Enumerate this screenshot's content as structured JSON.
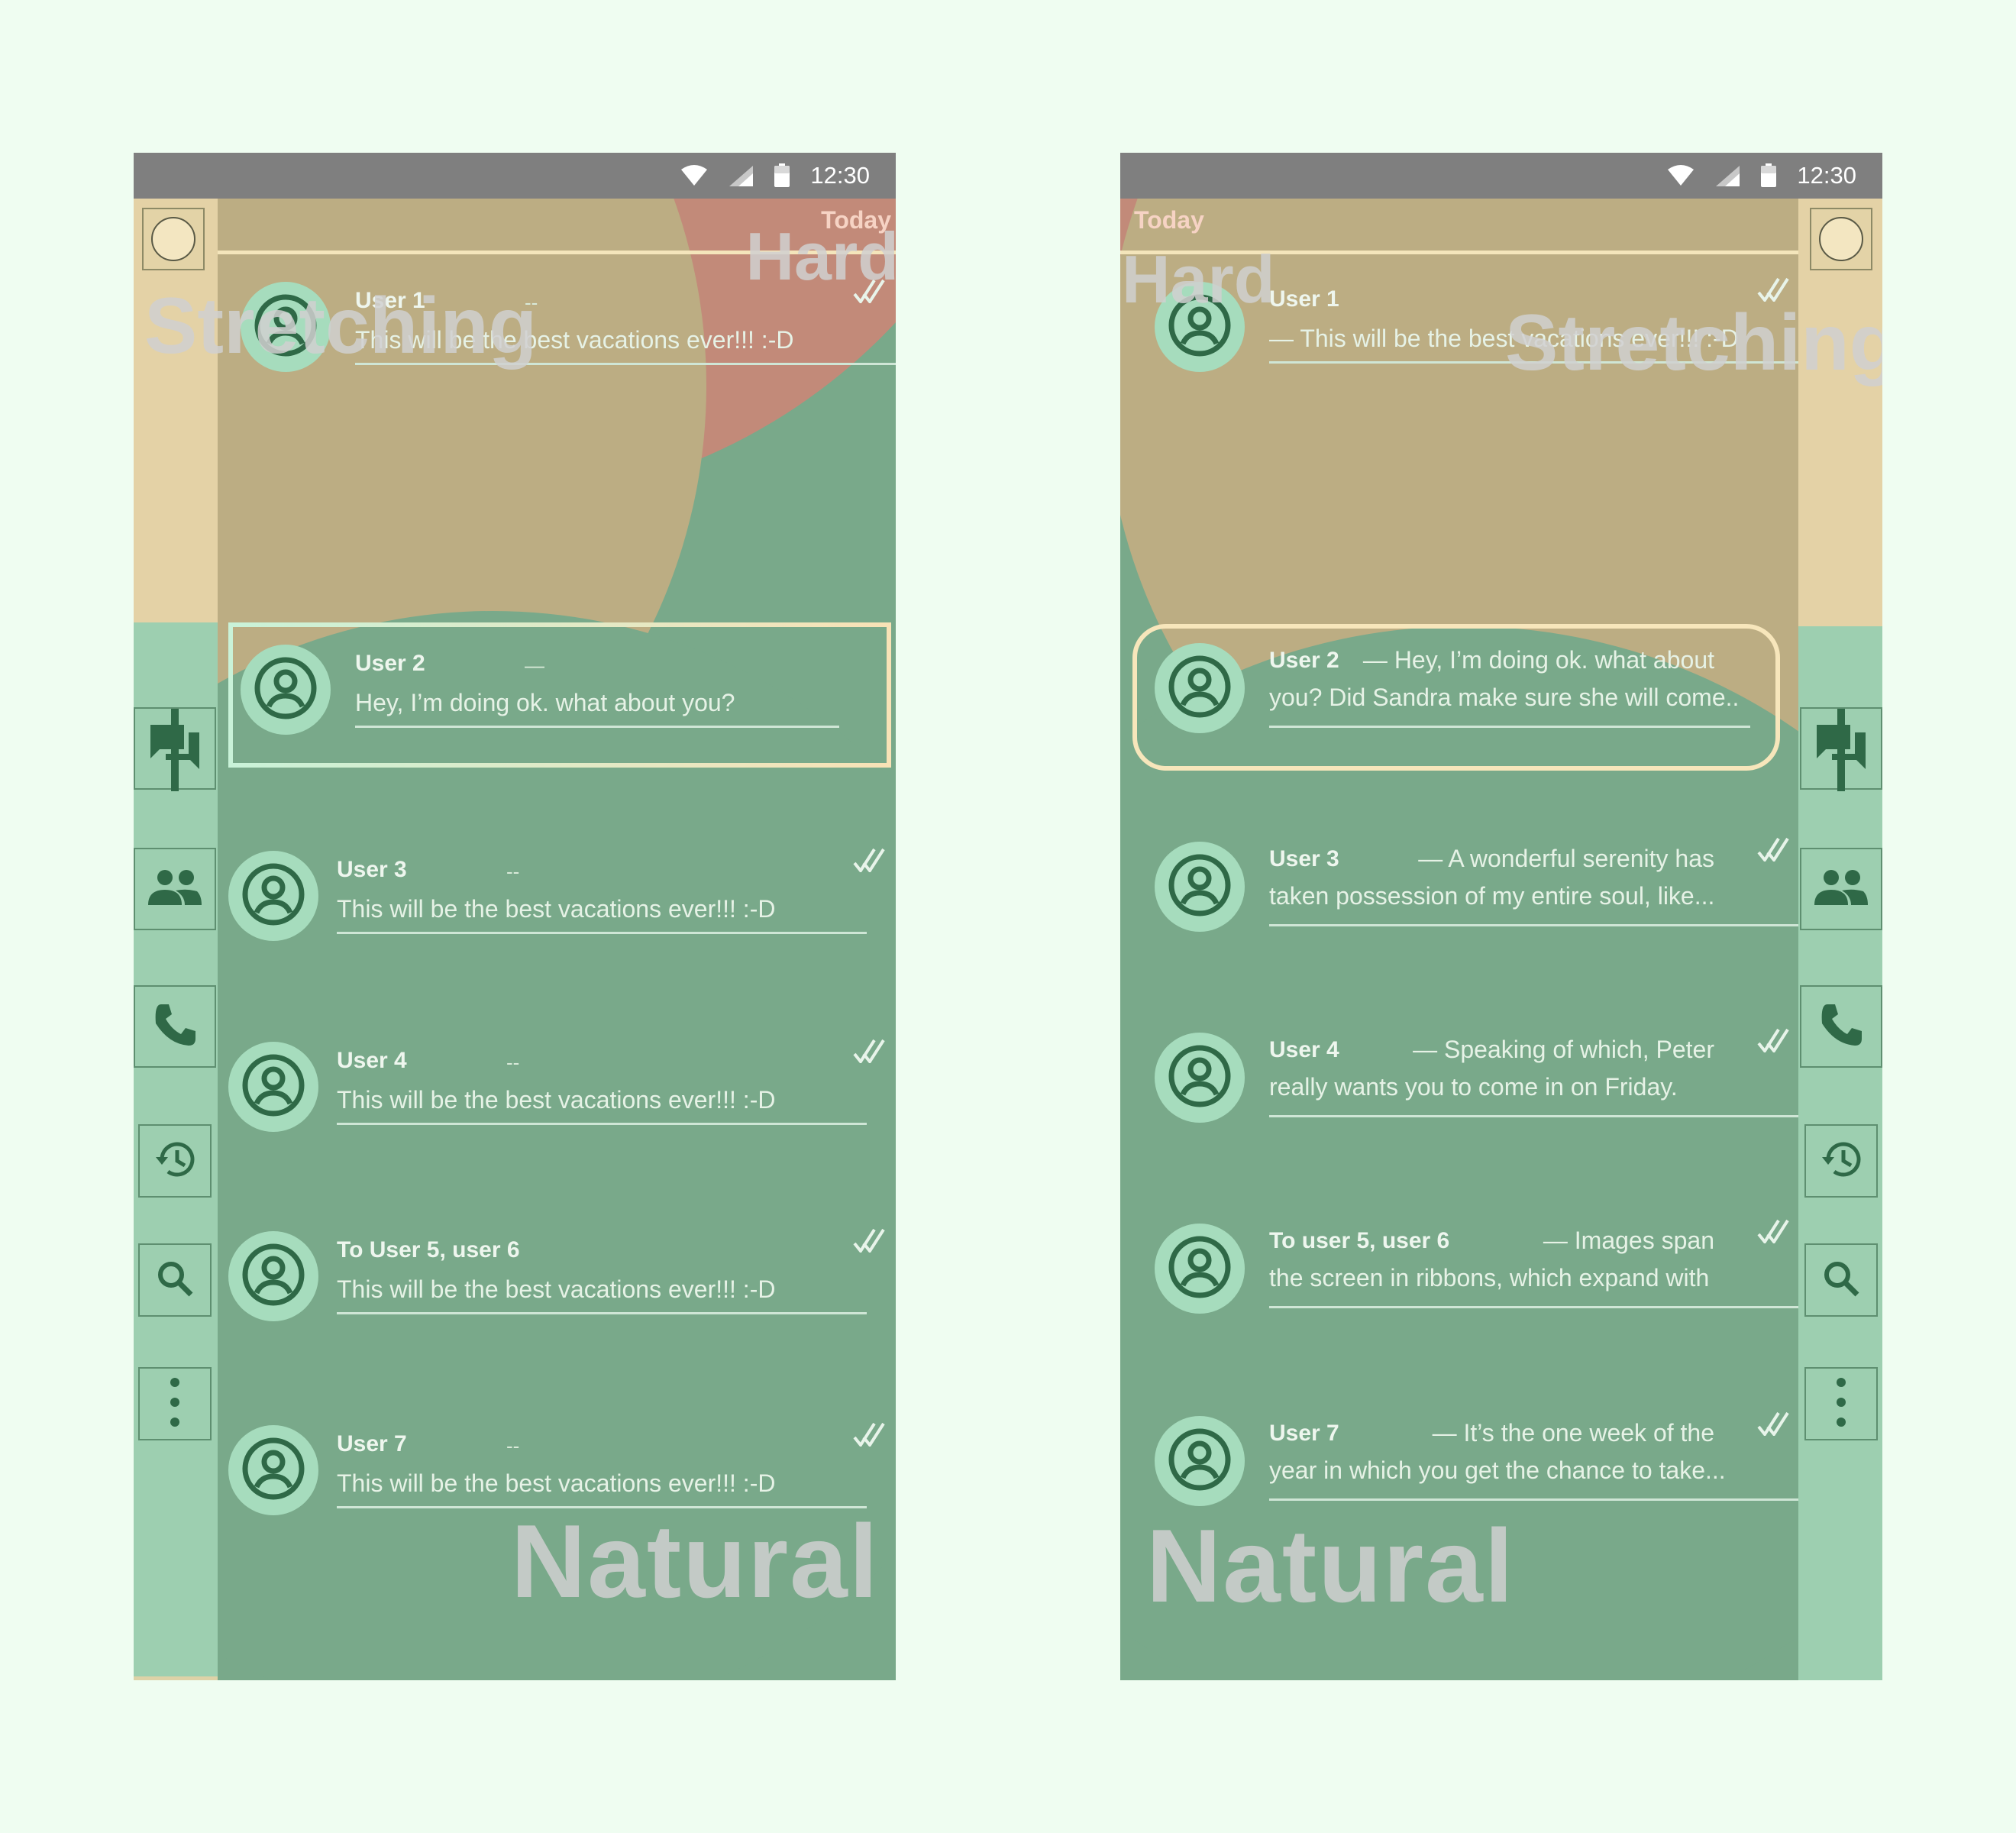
{
  "status_bar": {
    "time": "12:30"
  },
  "labels": {
    "today": "Today",
    "natural": "Natural",
    "hard": "Hard",
    "stretching": "Stretching"
  },
  "icons": {
    "sidebar": [
      "profile-circle-icon",
      "chat-icon",
      "people-icon",
      "phone-icon",
      "history-icon",
      "search-icon",
      "more-vert-icon"
    ],
    "status": [
      "wifi-icon",
      "signal-icon",
      "battery-icon"
    ],
    "row": [
      "avatar-icon",
      "double-check-icon"
    ]
  },
  "colors": {
    "status_bar": "#7f7f7f",
    "page_background": "#effdf1",
    "list_green": "#79a98a",
    "accent_dark": "#2f6947",
    "sand": "#bcad83",
    "terracotta": "#c28a79"
  },
  "left_phone": {
    "conversations": [
      {
        "name": "User 1",
        "dash": "--",
        "message": "This  will be the best vacations ever!!! :-D",
        "check": true
      },
      {
        "name": "User 2",
        "dash": "—",
        "message": "Hey, I’m doing ok. what about you?",
        "check": false,
        "selected": true
      },
      {
        "name": "User 3",
        "dash": "--",
        "message": "This  will be the best vacations ever!!! :-D",
        "check": true
      },
      {
        "name": "User 4",
        "dash": "--",
        "message": "This  will be the best vacations ever!!! :-D",
        "check": true
      },
      {
        "name": "To User 5, user 6",
        "dash": "",
        "message": "This  will be the best vacations ever!!! :-D",
        "check": true
      },
      {
        "name": "User 7",
        "dash": "--",
        "message": "This  will be the best vacations ever!!! :-D",
        "check": true
      }
    ]
  },
  "right_phone": {
    "conversations": [
      {
        "name": "User 1",
        "message": "— This  will be the best vacations ever!!! :-D",
        "check": true
      },
      {
        "name": "User 2",
        "message_line1": "— Hey, I’m doing ok. what about",
        "message_line2": "you? Did Sandra make sure she will come..",
        "check": false,
        "selected": true
      },
      {
        "name": "User 3",
        "message_line1": "— A wonderful serenity has",
        "message_line2": "taken possession of my entire soul, like...",
        "check": true
      },
      {
        "name": "User 4",
        "message_line1": "— Speaking of which, Peter",
        "message_line2": "really wants you to come in on Friday.",
        "check": true
      },
      {
        "name": "To user 5, user 6",
        "message_line1": "— Images span",
        "message_line2": "the screen in ribbons, which expand with",
        "check": true
      },
      {
        "name": "User 7",
        "message_line1": "— It’s the one week of the",
        "message_line2": "year in which you get the chance to take...",
        "check": true
      }
    ]
  }
}
